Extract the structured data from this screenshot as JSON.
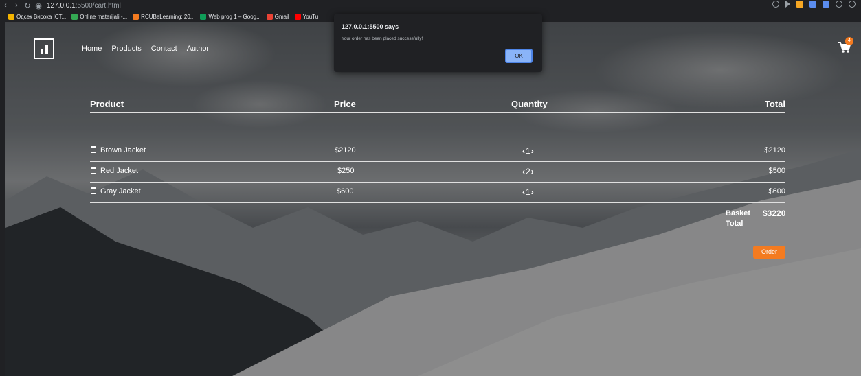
{
  "browser": {
    "url_host": "127.0.0.1",
    "url_rest": ":5500/cart.html",
    "bookmarks": [
      {
        "label": "Одсек Висока ICT...",
        "color": "#f4b400"
      },
      {
        "label": "Online materijali -...",
        "color": "#34a853"
      },
      {
        "label": "RCUBeLearning: 20...",
        "color": "#f47b20"
      },
      {
        "label": "Web prog 1 – Goog...",
        "color": "#0f9d58"
      },
      {
        "label": "Gmail",
        "color": "#ea4335"
      },
      {
        "label": "YouTu",
        "color": "#ff0000"
      }
    ]
  },
  "nav": {
    "items": [
      "Home",
      "Products",
      "Contact",
      "Author"
    ],
    "cart_count": "4"
  },
  "table": {
    "headers": {
      "product": "Product",
      "price": "Price",
      "quantity": "Quantity",
      "total": "Total"
    },
    "rows": [
      {
        "product": "Brown Jacket",
        "price": "$2120",
        "quantity": "1",
        "total": "$2120"
      },
      {
        "product": "Red Jacket",
        "price": "$250",
        "quantity": "2",
        "total": "$500"
      },
      {
        "product": "Gray Jacket",
        "price": "$600",
        "quantity": "1",
        "total": "$600"
      }
    ],
    "basket_total_label": "Basket Total",
    "basket_total_value": "$3220",
    "order_label": "Order"
  },
  "dialog": {
    "title": "127.0.0.1:5500 says",
    "message": "Your order has been placed successfully!",
    "ok_label": "OK"
  },
  "colors": {
    "accent": "#f47b20",
    "dialog_button": "#8ab4f8"
  }
}
